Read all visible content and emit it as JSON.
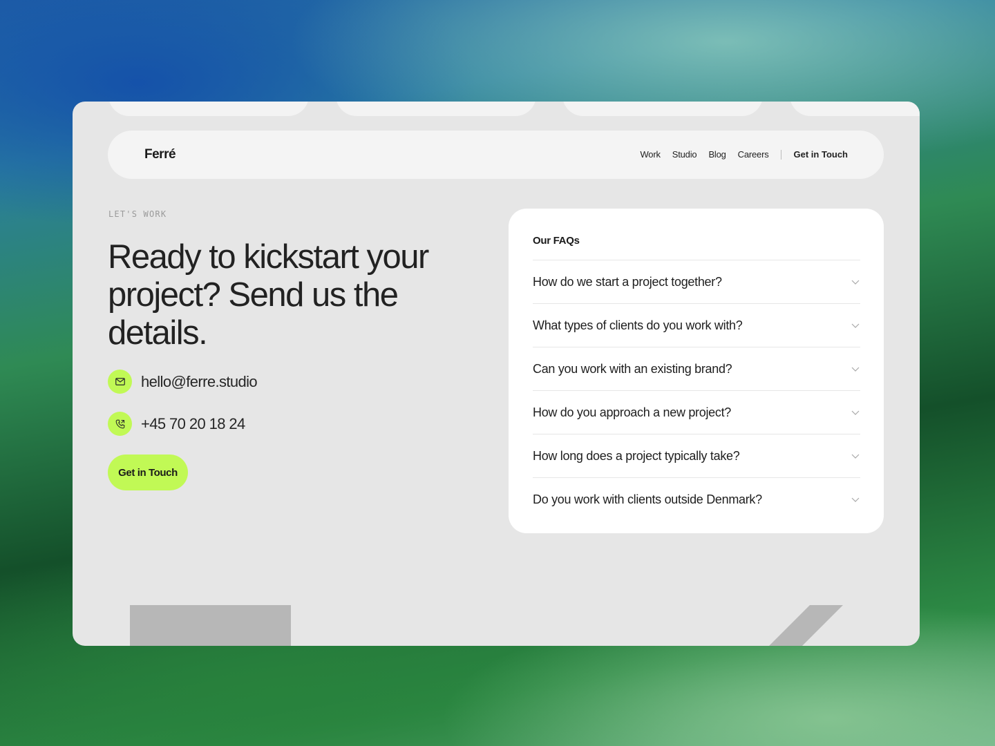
{
  "nav": {
    "logo": "Ferré",
    "links": [
      "Work",
      "Studio",
      "Blog",
      "Careers"
    ],
    "cta": "Get in Touch"
  },
  "hero": {
    "eyebrow": "LET'S WORK",
    "headline": "Ready to kickstart your project? Send us the details.",
    "email": "hello@ferre.studio",
    "phone": "+45 70 20 18 24",
    "button": "Get in Touch"
  },
  "faq": {
    "title": "Our FAQs",
    "items": [
      "How do we start a project together?",
      "What types of clients do you work with?",
      "Can you work with an existing brand?",
      "How do you approach a new project?",
      "How long does a project typically take?",
      "Do you work with clients outside Denmark?"
    ]
  },
  "colors": {
    "accent": "#c1f955",
    "card": "#e6e6e6",
    "panel": "#ffffff",
    "text": "#222222"
  },
  "icons": {
    "email": "mail-icon",
    "phone": "phone-icon",
    "faq": "chevron-down-icon"
  }
}
